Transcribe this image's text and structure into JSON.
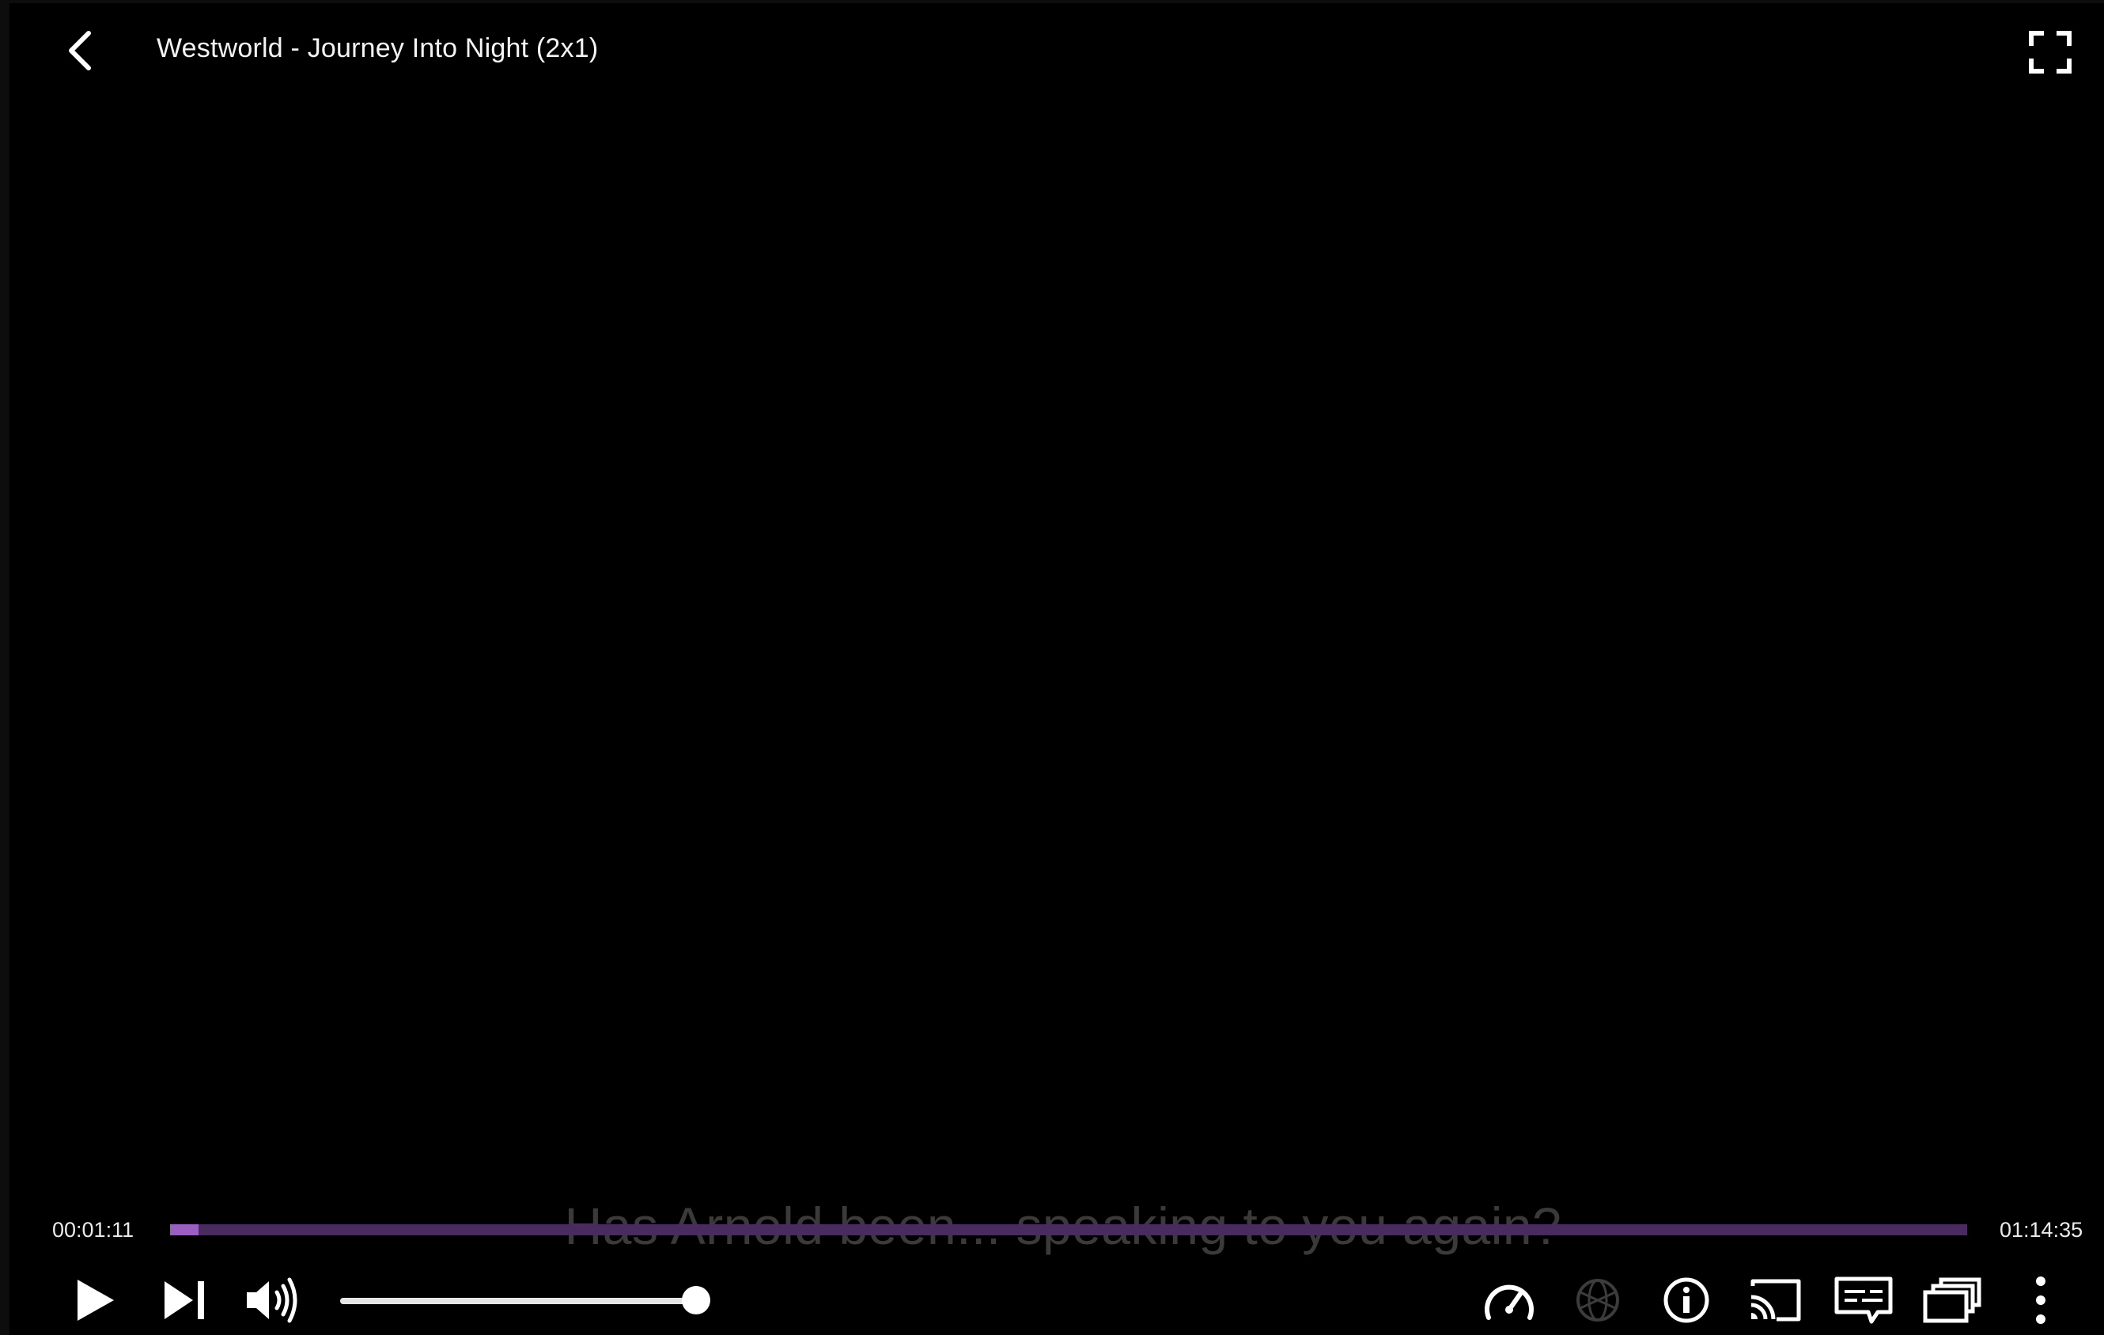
{
  "player": {
    "title": "Westworld - Journey Into Night (2x1)",
    "subtitle": "Has Arnold been... speaking to you again?",
    "time_current": "00:01:11",
    "time_total": "01:14:35",
    "progress_fraction": 0.0159,
    "volume_fraction": 1.0,
    "colors": {
      "background": "#000000",
      "accent": "#9b5fc2",
      "seek_track": "#4a2b5f",
      "subtitle": "#3a3a3a"
    }
  },
  "icons": {
    "back": "chevron-left-icon",
    "fullscreen": "fullscreen-icon",
    "play": "play-icon",
    "next": "skip-next-icon",
    "volume": "volume-up-icon",
    "speed": "speedometer-icon",
    "quality": "globe-icon",
    "info": "info-icon",
    "cast": "cast-icon",
    "subtitles": "subtitles-icon",
    "picture_in_picture": "picture-in-picture-icon",
    "more": "more-vert-icon"
  }
}
